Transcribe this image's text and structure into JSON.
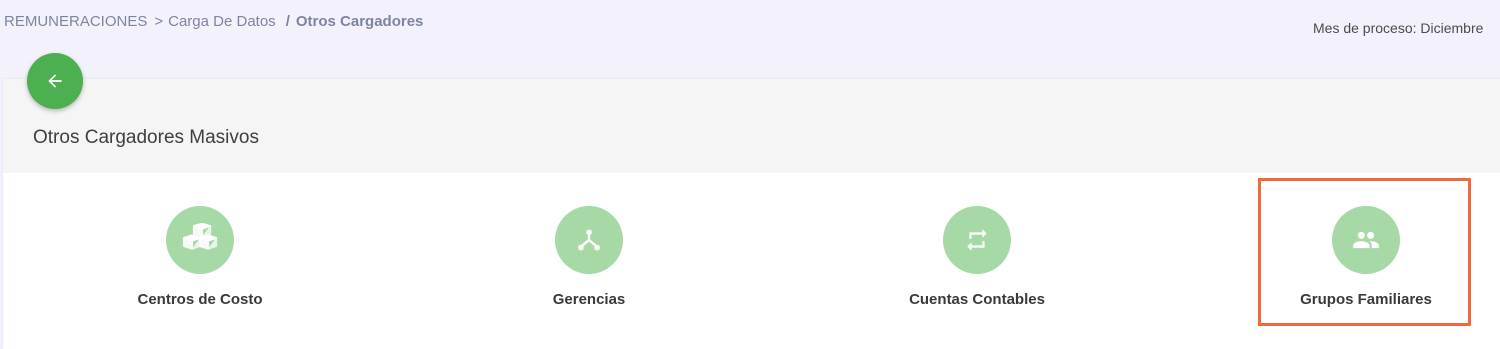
{
  "breadcrumb": {
    "root": "REMUNERACIONES",
    "separator1": ">",
    "section": "Carga De Datos",
    "separator2": "/",
    "current": "Otros Cargadores"
  },
  "process": {
    "label": "Mes de proceso: Diciembre"
  },
  "card": {
    "title": "Otros Cargadores Masivos",
    "back_icon": "arrow-left-icon"
  },
  "loaders": [
    {
      "label": "Centros de Costo",
      "icon": "cubes-icon"
    },
    {
      "label": "Gerencias",
      "icon": "hierarchy-icon"
    },
    {
      "label": "Cuentas Contables",
      "icon": "repeat-icon"
    },
    {
      "label": "Grupos Familiares",
      "icon": "people-icon",
      "highlighted": true
    }
  ],
  "colors": {
    "accent_green": "#4caf50",
    "icon_circle": "#a6d9a6",
    "highlight_border": "#ef6b3a",
    "breadcrumb_text": "#7d84a3"
  }
}
